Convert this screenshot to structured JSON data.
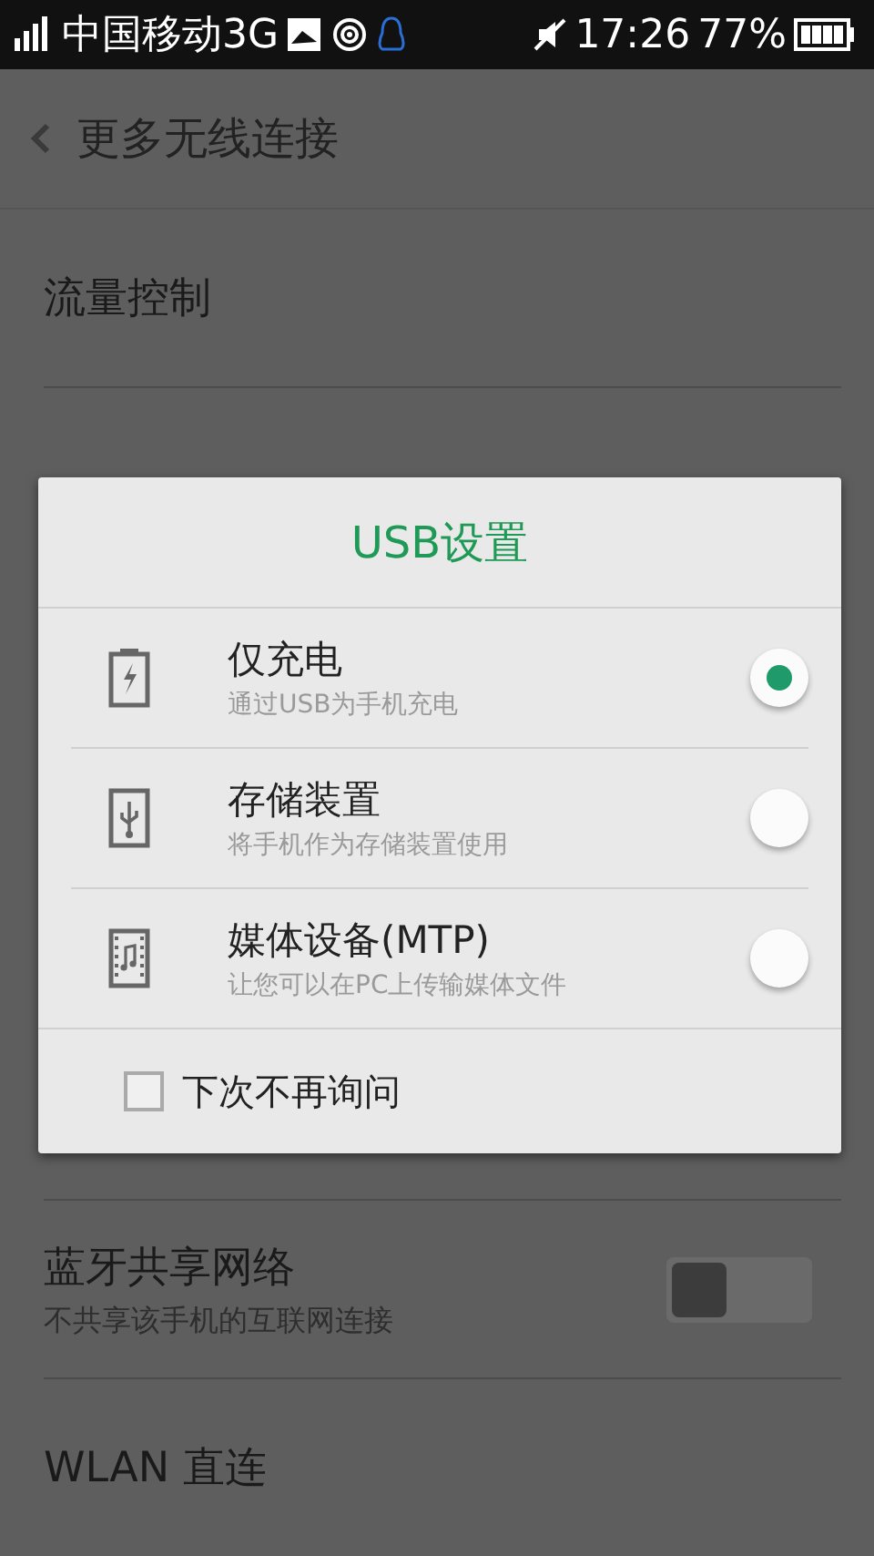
{
  "status_bar": {
    "carrier": "中国移动3G",
    "time": "17:26",
    "battery": "77%"
  },
  "header": {
    "title": "更多无线连接"
  },
  "settings": [
    {
      "kind": "plain",
      "title": "流量控制"
    },
    {
      "kind": "blank"
    },
    {
      "kind": "blank"
    },
    {
      "kind": "blank"
    },
    {
      "kind": "blank"
    },
    {
      "kind": "toggle",
      "title": "蓝牙共享网络",
      "subtitle": "不共享该手机的互联网连接",
      "on": false
    },
    {
      "kind": "plain",
      "title": "WLAN 直连"
    }
  ],
  "dialog": {
    "title": "USB设置",
    "options": [
      {
        "kind": "battery",
        "label": "仅充电",
        "description": "通过USB为手机充电",
        "selected": true
      },
      {
        "kind": "usb",
        "label": "存储装置",
        "description": "将手机作为存储装置使用",
        "selected": false
      },
      {
        "kind": "media",
        "label": "媒体设备(MTP)",
        "description": "让您可以在PC上传输媒体文件",
        "selected": false
      }
    ],
    "dont_ask": {
      "label": "下次不再询问",
      "checked": false
    }
  }
}
